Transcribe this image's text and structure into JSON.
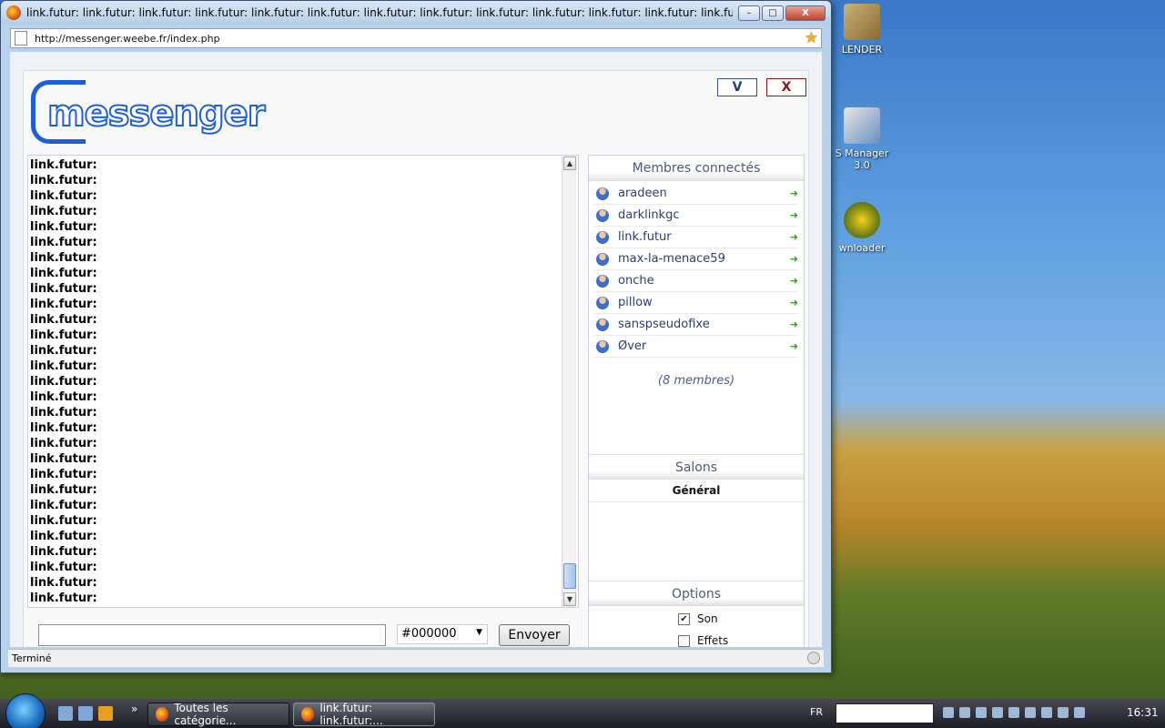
{
  "desktop": {
    "icons": [
      {
        "label": "LENDER"
      },
      {
        "label": "S Manager 3.0"
      },
      {
        "label": "wnloader"
      }
    ]
  },
  "window": {
    "title": "link.futur: link.futur: link.futur: link.futur: link.futur: link.futur: link.futur: link.futur: link.futur: link.futur: link.futur: link.futur: link.futur: link.f...",
    "minimize": "–",
    "maximize": "□",
    "close": "X",
    "url": "http://messenger.weebe.fr/index.php",
    "status": "Terminé"
  },
  "app": {
    "logo_text": "messenger",
    "btn_v": "V",
    "btn_x": "X",
    "chat_lines": [
      "link.futur:",
      "link.futur:",
      "link.futur:",
      "link.futur:",
      "link.futur:",
      "link.futur:",
      "link.futur:",
      "link.futur:",
      "link.futur:",
      "link.futur:",
      "link.futur:",
      "link.futur:",
      "link.futur:",
      "link.futur:",
      "link.futur:",
      "link.futur:",
      "link.futur:",
      "link.futur:",
      "link.futur:",
      "link.futur:",
      "link.futur:",
      "link.futur:",
      "link.futur:",
      "link.futur:",
      "link.futur:",
      "link.futur:",
      "link.futur:",
      "link.futur:",
      "link.futur:"
    ],
    "composer": {
      "input_value": "",
      "color_value": "#000000",
      "send_label": "Envoyer"
    },
    "members": {
      "title": "Membres connectés",
      "list": [
        "aradeen",
        "darklinkgc",
        "link.futur",
        "max-la-menace59",
        "onche",
        "pillow",
        "sanspseudofixe",
        "Øver"
      ],
      "count": "(8 membres)"
    },
    "salons": {
      "title": "Salons",
      "list": [
        "Général"
      ]
    },
    "options": {
      "title": "Options",
      "items": [
        {
          "label": "Son",
          "checked": true
        },
        {
          "label": "Effets",
          "checked": false
        }
      ]
    }
  },
  "taskbar": {
    "tasks": [
      {
        "label": "Toutes les catégorie...",
        "active": false
      },
      {
        "label": "link.futur: link.futur:...",
        "active": true
      }
    ],
    "lang": "FR",
    "clock": "16:31",
    "chevron": "»"
  }
}
